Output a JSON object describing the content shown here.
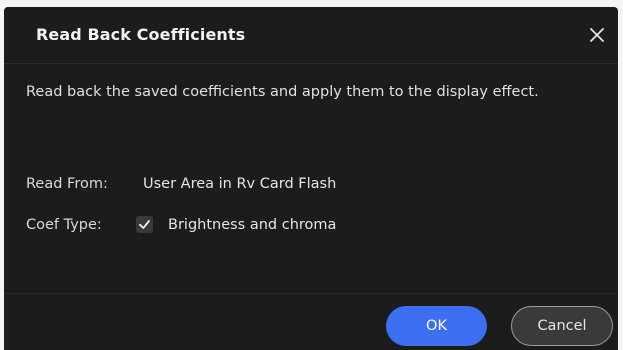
{
  "dialog": {
    "title": "Read Back Coefficients",
    "description": "Read back the saved coefficients and apply them to the display effect.",
    "read_from_label": "Read From:",
    "read_from_value": "User Area in Rv Card Flash",
    "coef_type_label": "Coef Type:",
    "coef_type_option": "Brightness and chroma",
    "coef_type_checked": true,
    "ok_label": "OK",
    "cancel_label": "Cancel"
  },
  "colors": {
    "dialog_bg": "#1c1c1c",
    "accent": "#3d6ff2",
    "button_secondary": "#3a3a3a"
  },
  "icons": {
    "close": "close-icon",
    "check": "checkmark-icon"
  }
}
